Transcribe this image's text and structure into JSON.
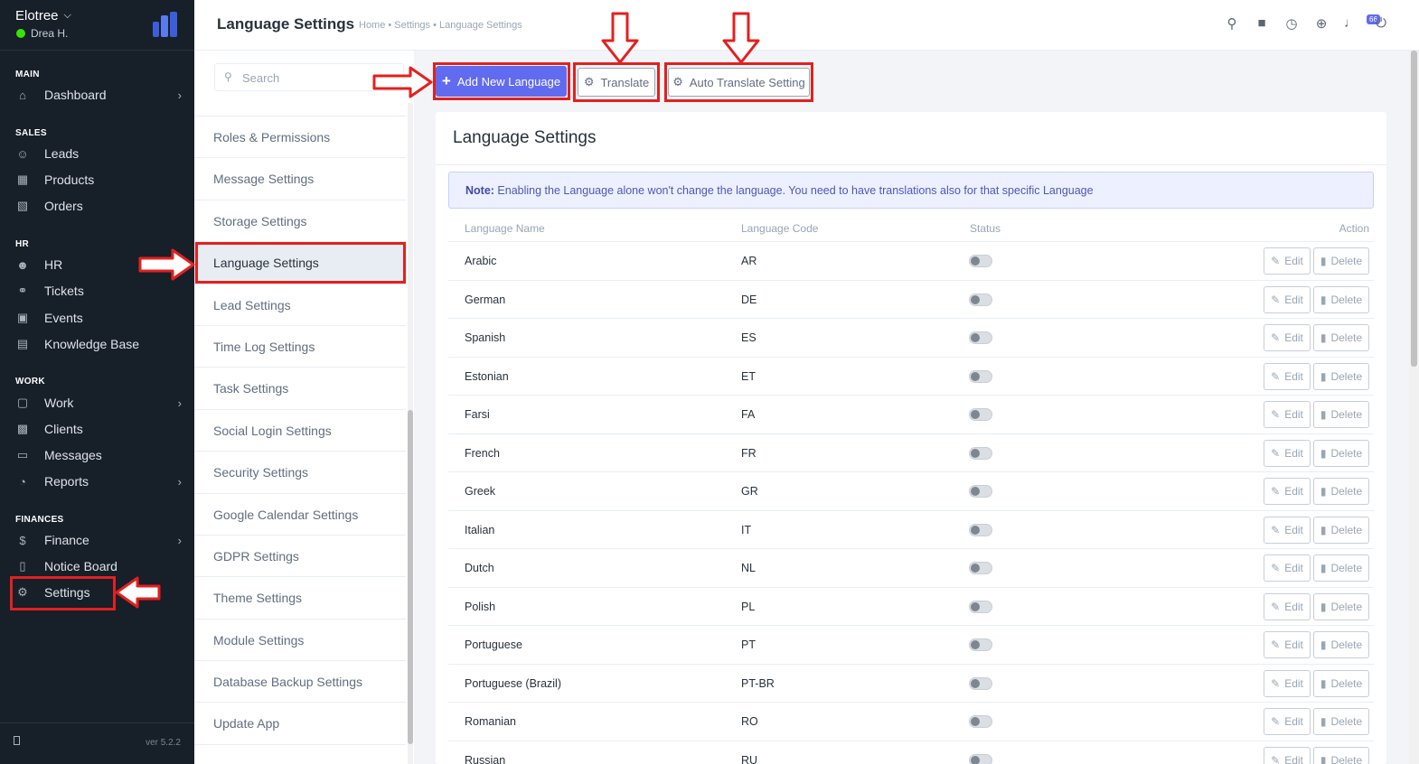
{
  "nav": {
    "company": "Elotree",
    "user": "Drea H.",
    "version": "ver 5.2.2",
    "sections": {
      "main": "MAIN",
      "sales": "SALES",
      "hr": "HR",
      "work": "WORK",
      "finances": "FINANCES"
    },
    "items": {
      "dashboard": "Dashboard",
      "leads": "Leads",
      "products": "Products",
      "orders": "Orders",
      "hr": "HR",
      "tickets": "Tickets",
      "events": "Events",
      "knowledge_base": "Knowledge Base",
      "work": "Work",
      "clients": "Clients",
      "messages": "Messages",
      "reports": "Reports",
      "finance": "Finance",
      "notice_board": "Notice Board",
      "settings": "Settings"
    }
  },
  "header": {
    "title": "Language Settings",
    "breadcrumb": "Home • Settings • Language Settings",
    "notification_count": "66"
  },
  "settings_menu": {
    "search_placeholder": "Search",
    "items": [
      "Roles & Permissions",
      "Message Settings",
      "Storage Settings",
      "Language Settings",
      "Lead Settings",
      "Time Log Settings",
      "Task Settings",
      "Social Login Settings",
      "Security Settings",
      "Google Calendar Settings",
      "GDPR Settings",
      "Theme Settings",
      "Module Settings",
      "Database Backup Settings",
      "Update App"
    ]
  },
  "actions": {
    "add_language": "Add New Language",
    "translate": "Translate",
    "auto_translate": "Auto Translate Setting"
  },
  "card": {
    "title": "Language Settings",
    "note_label": "Note:",
    "note_text": " Enabling the Language alone won't change the language. You need to have translations also for that specific Language",
    "columns": {
      "name": "Language Name",
      "code": "Language Code",
      "status": "Status",
      "action": "Action"
    },
    "edit_label": "Edit",
    "delete_label": "Delete",
    "rows": [
      {
        "name": "Arabic",
        "code": "AR",
        "enabled": false
      },
      {
        "name": "German",
        "code": "DE",
        "enabled": false
      },
      {
        "name": "Spanish",
        "code": "ES",
        "enabled": false
      },
      {
        "name": "Estonian",
        "code": "ET",
        "enabled": false
      },
      {
        "name": "Farsi",
        "code": "FA",
        "enabled": false
      },
      {
        "name": "French",
        "code": "FR",
        "enabled": false
      },
      {
        "name": "Greek",
        "code": "GR",
        "enabled": false
      },
      {
        "name": "Italian",
        "code": "IT",
        "enabled": false
      },
      {
        "name": "Dutch",
        "code": "NL",
        "enabled": false
      },
      {
        "name": "Polish",
        "code": "PL",
        "enabled": false
      },
      {
        "name": "Portuguese",
        "code": "PT",
        "enabled": false
      },
      {
        "name": "Portuguese (Brazil)",
        "code": "PT-BR",
        "enabled": false
      },
      {
        "name": "Romanian",
        "code": "RO",
        "enabled": false
      },
      {
        "name": "Russian",
        "code": "RU",
        "enabled": false
      }
    ]
  },
  "colors": {
    "accent": "#616bef",
    "sidebar": "#171f29",
    "annotation": "#e3201f"
  }
}
